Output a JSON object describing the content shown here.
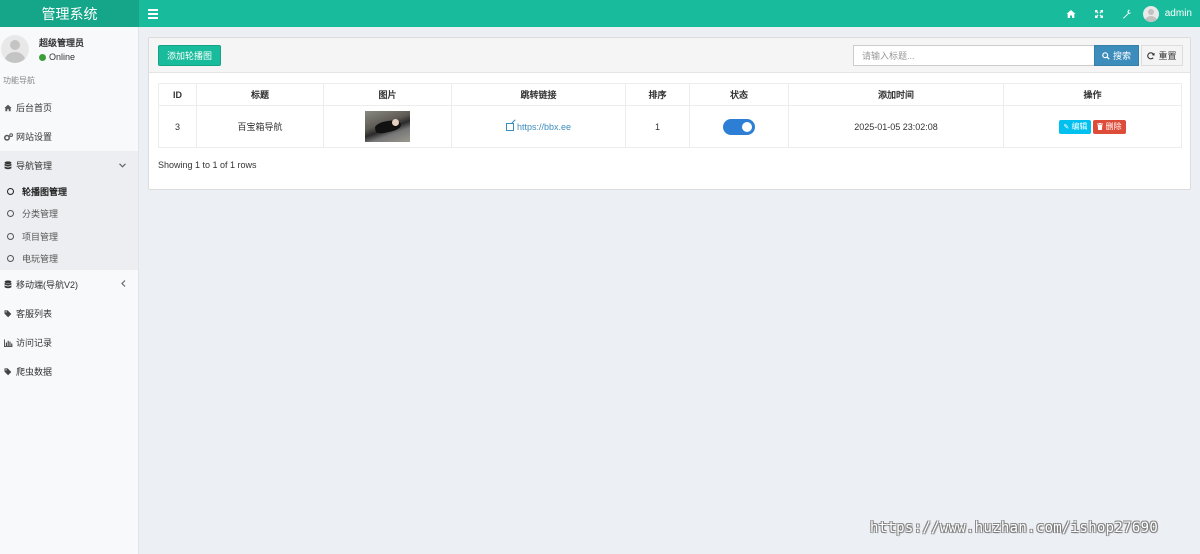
{
  "app": {
    "title": "管理系统"
  },
  "topbar": {
    "user_name": "admin"
  },
  "sidebar": {
    "user_title": "超级管理员",
    "user_status": "Online",
    "nav_header": "功能导航",
    "items": {
      "home": "后台首页",
      "site_settings": "网站设置",
      "nav_management": "导航管理",
      "mobile_nav": "移动端(导航V2)",
      "customer_service": "客服列表",
      "visit_logs": "访问记录",
      "crawler_data": "爬虫数据"
    },
    "sub_items": {
      "carousel": "轮播图管理",
      "category": "分类管理",
      "project": "项目管理",
      "games": "电玩管理"
    }
  },
  "toolbar": {
    "add_label": "添加轮播图",
    "search_placeholder": "请输入标题...",
    "search_label": "搜索",
    "reset_label": "重置"
  },
  "table": {
    "headers": {
      "id": "ID",
      "title": "标题",
      "image": "图片",
      "link": "跳转链接",
      "sort": "排序",
      "status": "状态",
      "created": "添加时间",
      "actions": "操作"
    },
    "rows": [
      {
        "id": "3",
        "title": "百宝箱导航",
        "link": "https://bbx.ee",
        "sort": "1",
        "status_on": true,
        "created": "2025-01-05 23:02:08",
        "edit_label": "编辑",
        "delete_label": "删除"
      }
    ],
    "pager_info": "Showing 1 to 1 of 1 rows"
  },
  "watermark": "https://www.huzhan.com/ishop27690",
  "colors": {
    "brand": "#18bc9c",
    "primary": "#3c8dbc",
    "info": "#00c0ef",
    "danger": "#dd4b39"
  }
}
